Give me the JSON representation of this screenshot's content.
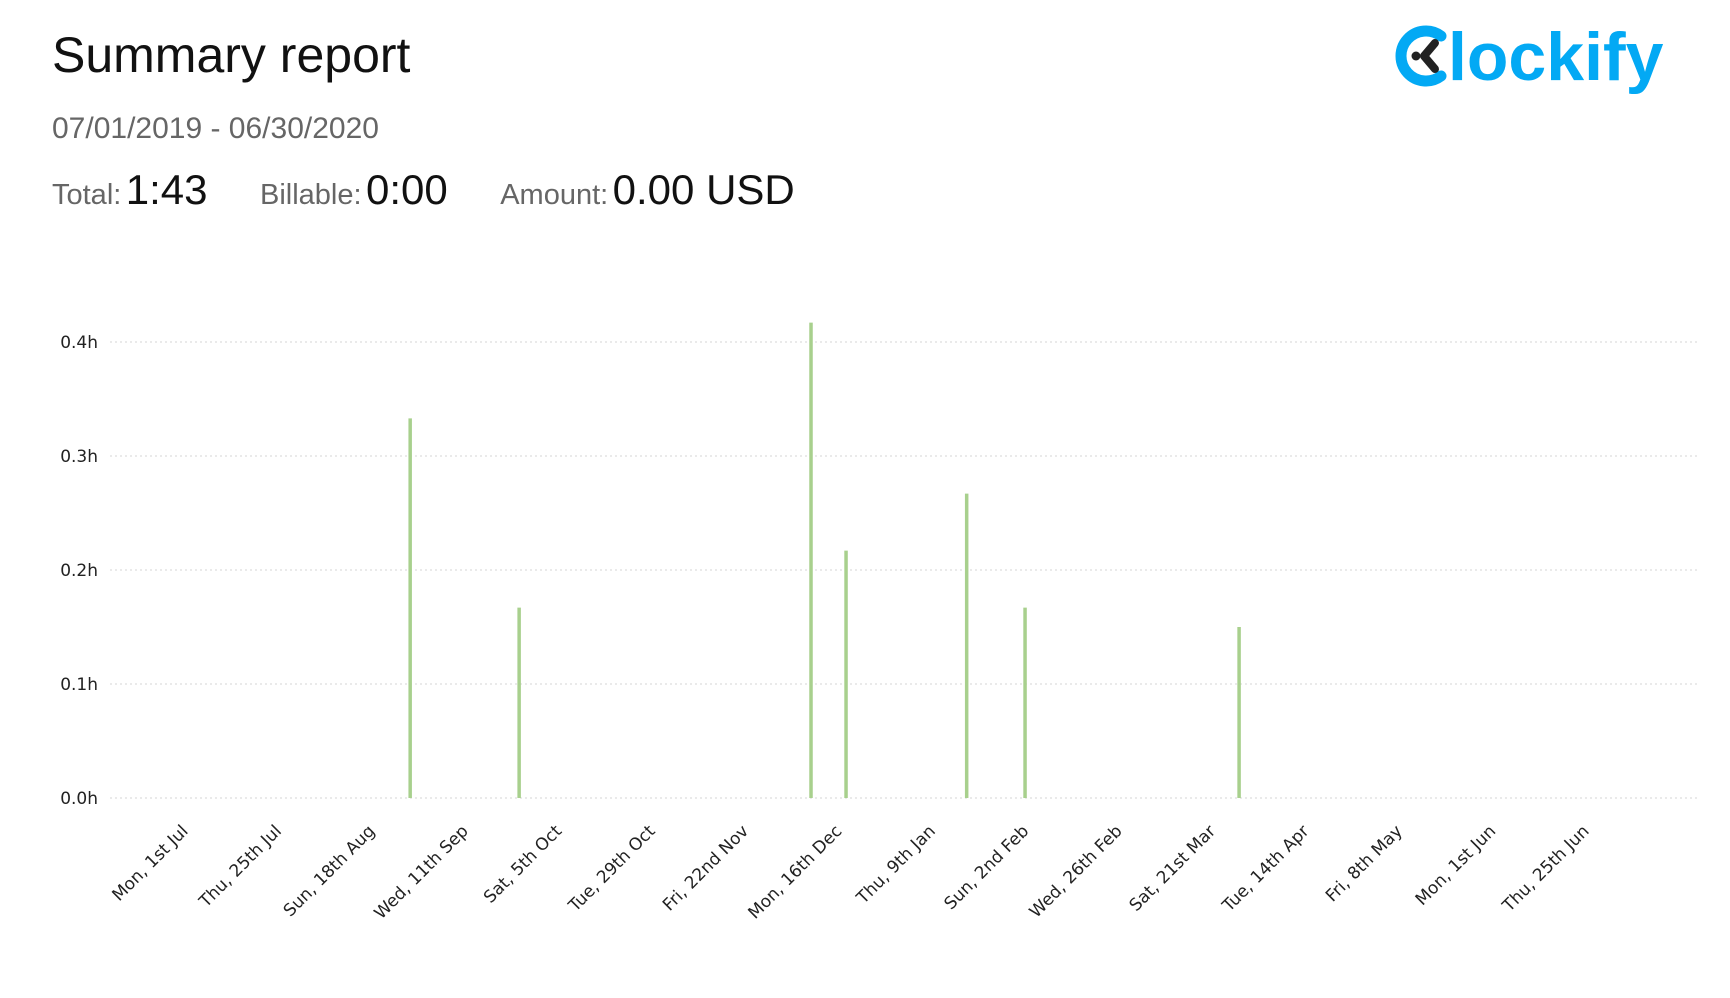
{
  "header": {
    "title": "Summary report",
    "date_range": "07/01/2019 - 06/30/2020",
    "total_label": "Total:",
    "total_value": "1:43",
    "billable_label": "Billable:",
    "billable_value": "0:00",
    "amount_label": "Amount:",
    "amount_value": "0.00 USD"
  },
  "logo": {
    "text": "lockify",
    "icon": "clockify-c-icon",
    "color": "#03a9f4"
  },
  "colors": {
    "bar": "#a8d08d",
    "grid": "#d6d6d6",
    "axis_text": "#222222"
  },
  "chart_data": {
    "type": "bar",
    "x_start": "2019-07-01",
    "x_end": "2020-06-30",
    "x_ticks": [
      {
        "date": "2019-07-01",
        "label": "Mon, 1st Jul"
      },
      {
        "date": "2019-07-25",
        "label": "Thu, 25th Jul"
      },
      {
        "date": "2019-08-18",
        "label": "Sun, 18th Aug"
      },
      {
        "date": "2019-09-11",
        "label": "Wed, 11th Sep"
      },
      {
        "date": "2019-10-05",
        "label": "Sat, 5th Oct"
      },
      {
        "date": "2019-10-29",
        "label": "Tue, 29th Oct"
      },
      {
        "date": "2019-11-22",
        "label": "Fri, 22nd Nov"
      },
      {
        "date": "2019-12-16",
        "label": "Mon, 16th Dec"
      },
      {
        "date": "2020-01-09",
        "label": "Thu, 9th Jan"
      },
      {
        "date": "2020-02-02",
        "label": "Sun, 2nd Feb"
      },
      {
        "date": "2020-02-26",
        "label": "Wed, 26th Feb"
      },
      {
        "date": "2020-03-21",
        "label": "Sat, 21st Mar"
      },
      {
        "date": "2020-04-14",
        "label": "Tue, 14th Apr"
      },
      {
        "date": "2020-05-08",
        "label": "Fri, 8th May"
      },
      {
        "date": "2020-06-01",
        "label": "Mon, 1st Jun"
      },
      {
        "date": "2020-06-25",
        "label": "Thu, 25th Jun"
      }
    ],
    "y_ticks": [
      {
        "value": 0.0,
        "label": "0.0h"
      },
      {
        "value": 0.1,
        "label": "0.1h"
      },
      {
        "value": 0.2,
        "label": "0.2h"
      },
      {
        "value": 0.3,
        "label": "0.3h"
      },
      {
        "value": 0.4,
        "label": "0.4h"
      }
    ],
    "ylim": [
      0,
      0.42
    ],
    "grid": true,
    "points": [
      {
        "date": "2019-09-02",
        "value": 0.333
      },
      {
        "date": "2019-09-30",
        "value": 0.167
      },
      {
        "date": "2019-12-14",
        "value": 0.417
      },
      {
        "date": "2019-12-23",
        "value": 0.217
      },
      {
        "date": "2020-01-23",
        "value": 0.267
      },
      {
        "date": "2020-02-07",
        "value": 0.167
      },
      {
        "date": "2020-04-02",
        "value": 0.15
      }
    ]
  }
}
